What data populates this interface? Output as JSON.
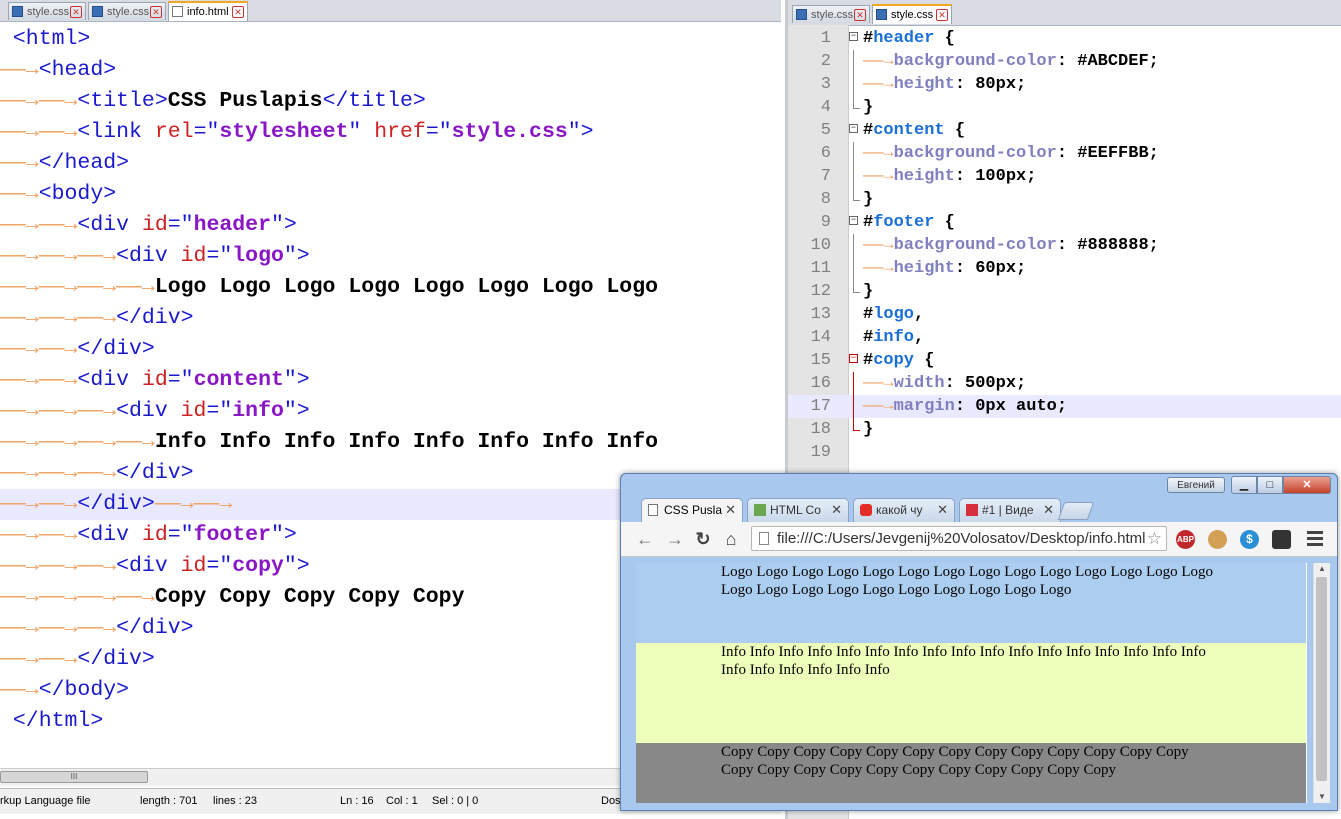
{
  "left_editor": {
    "tabs": [
      {
        "label": "style.css",
        "active": false
      },
      {
        "label": "style.css",
        "active": false
      },
      {
        "label": "info.html",
        "active": true
      }
    ],
    "lines": [
      {
        "arrows": "",
        "parts": [
          [
            "tag",
            "<html>"
          ]
        ]
      },
      {
        "arrows": "——→",
        "parts": [
          [
            "tag",
            "<head>"
          ]
        ]
      },
      {
        "arrows": "——→——→",
        "parts": [
          [
            "tag",
            "<title>"
          ],
          [
            "txt",
            "CSS Puslapis"
          ],
          [
            "tag",
            "</title>"
          ]
        ]
      },
      {
        "arrows": "——→——→",
        "parts": [
          [
            "tag",
            "<link "
          ],
          [
            "attr",
            "rel"
          ],
          [
            "tag",
            "=\""
          ],
          [
            "val",
            "stylesheet"
          ],
          [
            "tag",
            "\" "
          ],
          [
            "attr",
            "href"
          ],
          [
            "tag",
            "=\""
          ],
          [
            "val",
            "style.css"
          ],
          [
            "tag",
            "\">"
          ]
        ]
      },
      {
        "arrows": "——→",
        "parts": [
          [
            "tag",
            "</head>"
          ]
        ]
      },
      {
        "arrows": "——→",
        "parts": [
          [
            "tag",
            "<body>"
          ]
        ]
      },
      {
        "arrows": "——→——→",
        "parts": [
          [
            "tag",
            "<div "
          ],
          [
            "attr",
            "id"
          ],
          [
            "tag",
            "=\""
          ],
          [
            "val",
            "header"
          ],
          [
            "tag",
            "\">"
          ]
        ]
      },
      {
        "arrows": "——→——→——→",
        "parts": [
          [
            "tag",
            "<div "
          ],
          [
            "attr",
            "id"
          ],
          [
            "tag",
            "=\""
          ],
          [
            "val",
            "logo"
          ],
          [
            "tag",
            "\">"
          ]
        ]
      },
      {
        "arrows": "——→——→——→——→",
        "parts": [
          [
            "txt",
            "Logo Logo Logo Logo Logo Logo Logo Logo"
          ]
        ]
      },
      {
        "arrows": "——→——→——→",
        "parts": [
          [
            "tag",
            "</div>"
          ]
        ]
      },
      {
        "arrows": "——→——→",
        "parts": [
          [
            "tag",
            "</div>"
          ]
        ]
      },
      {
        "arrows": "——→——→",
        "parts": [
          [
            "tag",
            "<div "
          ],
          [
            "attr",
            "id"
          ],
          [
            "tag",
            "=\""
          ],
          [
            "val",
            "content"
          ],
          [
            "tag",
            "\">"
          ]
        ]
      },
      {
        "arrows": "——→——→——→",
        "parts": [
          [
            "tag",
            "<div "
          ],
          [
            "attr",
            "id"
          ],
          [
            "tag",
            "=\""
          ],
          [
            "val",
            "info"
          ],
          [
            "tag",
            "\">"
          ]
        ]
      },
      {
        "arrows": "——→——→——→——→",
        "parts": [
          [
            "txt",
            "Info Info Info Info Info Info Info Info"
          ]
        ]
      },
      {
        "arrows": "——→——→——→",
        "parts": [
          [
            "tag",
            "</div>"
          ]
        ]
      },
      {
        "arrows": "——→——→",
        "parts": [
          [
            "tag",
            "</div>"
          ],
          [
            "arrows",
            "——→——→"
          ]
        ],
        "highlight": true
      },
      {
        "arrows": "——→——→",
        "parts": [
          [
            "tag",
            "<div "
          ],
          [
            "attr",
            "id"
          ],
          [
            "tag",
            "=\""
          ],
          [
            "val",
            "footer"
          ],
          [
            "tag",
            "\">"
          ]
        ]
      },
      {
        "arrows": "——→——→——→",
        "parts": [
          [
            "tag",
            "<div "
          ],
          [
            "attr",
            "id"
          ],
          [
            "tag",
            "=\""
          ],
          [
            "val",
            "copy"
          ],
          [
            "tag",
            "\">"
          ]
        ]
      },
      {
        "arrows": "——→——→——→——→",
        "parts": [
          [
            "txt",
            "Copy Copy Copy Copy Copy"
          ]
        ]
      },
      {
        "arrows": "——→——→——→",
        "parts": [
          [
            "tag",
            "</div>"
          ]
        ]
      },
      {
        "arrows": "——→——→",
        "parts": [
          [
            "tag",
            "</div>"
          ]
        ]
      },
      {
        "arrows": "——→",
        "parts": [
          [
            "tag",
            "</body>"
          ]
        ]
      },
      {
        "arrows": "",
        "parts": [
          [
            "tag",
            "</html>"
          ]
        ]
      }
    ],
    "scroll_thumb": "III",
    "status": {
      "filetype": "rkup Language file",
      "length": "length : 701",
      "lines": "lines : 23",
      "ln": "Ln : 16",
      "col": "Col : 1",
      "sel": "Sel : 0 | 0",
      "eol": "Dos"
    }
  },
  "right_editor": {
    "tabs": [
      {
        "label": "style.css",
        "active": false
      },
      {
        "label": "style.css",
        "active": true
      }
    ],
    "lines": [
      {
        "n": "1",
        "fold": "open",
        "parts": [
          [
            "hash",
            "#"
          ],
          [
            "sel",
            "header"
          ],
          [
            "punct",
            " {"
          ]
        ]
      },
      {
        "n": "2",
        "fold": "line",
        "parts": [
          [
            "arrows",
            "——→"
          ],
          [
            "prop",
            "background-color"
          ],
          [
            "punct",
            ": "
          ],
          [
            "cval",
            "#ABCDEF"
          ],
          [
            "punct",
            ";"
          ]
        ]
      },
      {
        "n": "3",
        "fold": "line",
        "parts": [
          [
            "arrows",
            "——→"
          ],
          [
            "prop",
            "height"
          ],
          [
            "punct",
            ": "
          ],
          [
            "cval",
            "80px"
          ],
          [
            "punct",
            ";"
          ]
        ]
      },
      {
        "n": "4",
        "fold": "end",
        "parts": [
          [
            "punct",
            "}"
          ]
        ]
      },
      {
        "n": "5",
        "fold": "open",
        "parts": [
          [
            "hash",
            "#"
          ],
          [
            "sel",
            "content"
          ],
          [
            "punct",
            " {"
          ]
        ]
      },
      {
        "n": "6",
        "fold": "line",
        "parts": [
          [
            "arrows",
            "——→"
          ],
          [
            "prop",
            "background-color"
          ],
          [
            "punct",
            ": "
          ],
          [
            "cval",
            "#EEFFBB"
          ],
          [
            "punct",
            ";"
          ]
        ]
      },
      {
        "n": "7",
        "fold": "line",
        "parts": [
          [
            "arrows",
            "——→"
          ],
          [
            "prop",
            "height"
          ],
          [
            "punct",
            ": "
          ],
          [
            "cval",
            "100px"
          ],
          [
            "punct",
            ";"
          ]
        ]
      },
      {
        "n": "8",
        "fold": "end",
        "parts": [
          [
            "punct",
            "}"
          ]
        ]
      },
      {
        "n": "9",
        "fold": "open",
        "parts": [
          [
            "hash",
            "#"
          ],
          [
            "sel",
            "footer"
          ],
          [
            "punct",
            " {"
          ]
        ]
      },
      {
        "n": "10",
        "fold": "line",
        "parts": [
          [
            "arrows",
            "——→"
          ],
          [
            "prop",
            "background-color"
          ],
          [
            "punct",
            ": "
          ],
          [
            "cval",
            "#888888"
          ],
          [
            "punct",
            ";"
          ]
        ]
      },
      {
        "n": "11",
        "fold": "line",
        "parts": [
          [
            "arrows",
            "——→"
          ],
          [
            "prop",
            "height"
          ],
          [
            "punct",
            ": "
          ],
          [
            "cval",
            "60px"
          ],
          [
            "punct",
            ";"
          ]
        ]
      },
      {
        "n": "12",
        "fold": "end",
        "parts": [
          [
            "punct",
            "}"
          ]
        ]
      },
      {
        "n": "13",
        "fold": "",
        "parts": [
          [
            "hash",
            "#"
          ],
          [
            "sel",
            "logo"
          ],
          [
            "punct",
            ","
          ]
        ]
      },
      {
        "n": "14",
        "fold": "",
        "parts": [
          [
            "hash",
            "#"
          ],
          [
            "sel",
            "info"
          ],
          [
            "punct",
            ","
          ]
        ]
      },
      {
        "n": "15",
        "fold": "openred",
        "parts": [
          [
            "hash",
            "#"
          ],
          [
            "sel",
            "copy"
          ],
          [
            "punct",
            " {"
          ]
        ]
      },
      {
        "n": "16",
        "fold": "linered",
        "parts": [
          [
            "arrows",
            "——→"
          ],
          [
            "prop",
            "width"
          ],
          [
            "punct",
            ": "
          ],
          [
            "cval",
            "500px"
          ],
          [
            "punct",
            ";"
          ]
        ]
      },
      {
        "n": "17",
        "fold": "linered",
        "parts": [
          [
            "arrows",
            "——→"
          ],
          [
            "prop",
            "margin"
          ],
          [
            "punct",
            ": "
          ],
          [
            "cval",
            "0px auto"
          ],
          [
            "punct",
            ";"
          ]
        ],
        "highlight": true
      },
      {
        "n": "18",
        "fold": "end",
        "parts": [
          [
            "punct",
            "}"
          ]
        ]
      },
      {
        "n": "19",
        "fold": "",
        "parts": []
      }
    ]
  },
  "browser": {
    "user_button": "Евгений",
    "window_buttons": {
      "minimize": "▁",
      "maximize": "□",
      "close": "✕"
    },
    "tabs": [
      {
        "label": "CSS Pusla",
        "icon": "page-icon",
        "active": true
      },
      {
        "label": "HTML Co",
        "icon": "w3-icon",
        "active": false
      },
      {
        "label": "какой чу",
        "icon": "youtube-icon",
        "active": false
      },
      {
        "label": "#1 | Виде",
        "icon": "hash-icon",
        "active": false
      }
    ],
    "tab_close": "✕",
    "nav": {
      "back": "←",
      "forward": "→",
      "reload": "↻",
      "home": "⌂"
    },
    "url": "file:///C:/Users/Jevgenij%20Volosatov/Desktop/info.html",
    "star": "☆",
    "extensions": [
      {
        "name": "abp-icon",
        "label": "ABP",
        "color": "#c0282d"
      },
      {
        "name": "cookie-icon",
        "label": "",
        "color": "#d3a055"
      },
      {
        "name": "dollar-icon",
        "label": "$",
        "color": "#2a8fd6"
      },
      {
        "name": "glasses-icon",
        "label": "",
        "color": "#333333"
      }
    ],
    "page": {
      "header_text": "Logo Logo Logo Logo Logo Logo Logo Logo Logo Logo Logo Logo Logo Logo Logo Logo Logo Logo Logo Logo Logo Logo Logo Logo",
      "content_text": "Info Info Info Info Info Info Info Info Info Info Info Info Info Info Info Info Info Info Info Info Info Info Info",
      "footer_text": "Copy Copy Copy Copy Copy Copy Copy Copy Copy Copy Copy Copy Copy Copy Copy Copy Copy Copy Copy Copy Copy Copy Copy Copy",
      "colors": {
        "header": "#ABCDEF",
        "content": "#EEFFBB",
        "footer": "#888888"
      }
    },
    "scroll": {
      "up": "▲",
      "down": "▼"
    }
  }
}
